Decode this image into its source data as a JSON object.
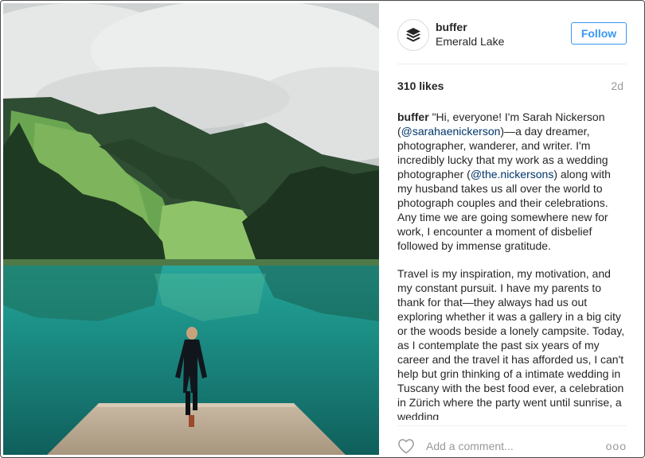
{
  "post": {
    "image_alt": "",
    "header": {
      "username": "buffer",
      "location": "Emerald Lake",
      "follow_label": "Follow",
      "avatar_icon": "buffer-logo-icon"
    },
    "likes": "310 likes",
    "age": "2d",
    "caption": {
      "username": "buffer",
      "p1_a": "\"Hi, everyone! I'm Sarah Nickerson (",
      "mention1": "@sarahaenickerson",
      "p1_b": ")—a day dreamer, photographer, wanderer, and writer. I'm incredibly lucky that my work as a wedding photographer (",
      "mention2": "@the.nickersons",
      "p1_c": ") along with my husband takes us all over the world to photograph couples and their celebrations. Any time we are going somewhere new for work, I encounter a moment of disbelief followed by immense gratitude.",
      "p2": "Travel is my inspiration, my motivation, and my constant pursuit. I have my parents to thank for that—they always had us out exploring whether it was a gallery in a big city or the woods beside a lonely campsite. Today, as I contemplate the past six years of my career and the travel it has afforded us, I can't help but grin thinking of a intimate wedding in Tuscany with the best food ever, a celebration in Zürich where the party went until sunrise, a wedding"
    },
    "comment": {
      "placeholder": "Add a comment...",
      "heart_icon": "heart-outline-icon",
      "more_label": "ooo"
    }
  },
  "colors": {
    "follow_blue": "#3897f0",
    "mention": "#003569",
    "muted": "#999999"
  }
}
